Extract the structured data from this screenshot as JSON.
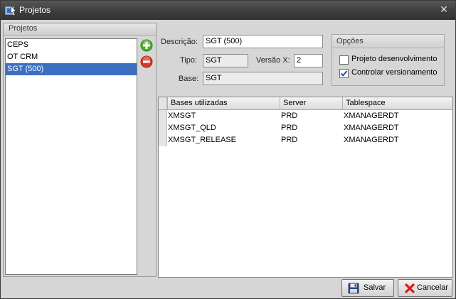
{
  "window": {
    "title": "Projetos"
  },
  "left_panel": {
    "header": "Projetos",
    "projects": [
      "CEPS",
      "OT CRM",
      "SGT (500)"
    ],
    "selected_index": 2
  },
  "form": {
    "descricao_label": "Descrição:",
    "descricao_value": "SGT (500)",
    "tipo_label": "Tipo:",
    "tipo_value": "SGT",
    "versao_label": "Versão X:",
    "versao_value": "2",
    "base_label": "Base:",
    "base_value": "SGT"
  },
  "opcoes": {
    "header": "Opções",
    "projeto_desenvolvimento": {
      "label": "Projeto desenvolvimento",
      "checked": false
    },
    "controlar_versionamento": {
      "label": "Controlar versionamento",
      "checked": true
    }
  },
  "grid": {
    "columns": [
      "Bases utilizadas",
      "Server",
      "Tablespace"
    ],
    "rows": [
      [
        "XMSGT",
        "PRD",
        "XMANAGERDT"
      ],
      [
        "XMSGT_QLD",
        "PRD",
        "XMANAGERDT"
      ],
      [
        "XMSGT_RELEASE",
        "PRD",
        "XMANAGERDT"
      ]
    ]
  },
  "buttons": {
    "salvar": "Salvar",
    "cancelar": "Cancelar"
  },
  "icons": {
    "add": "add-circle-icon",
    "remove": "remove-circle-icon",
    "save": "floppy-disk-icon",
    "cancel": "red-x-icon"
  },
  "colors": {
    "selection": "#3b6fc2",
    "titlebar": "#3f3f3f",
    "add_green": "#4caf32",
    "remove_red": "#d83a2a"
  }
}
